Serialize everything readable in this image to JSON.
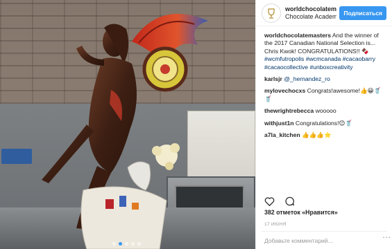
{
  "post": {
    "image_alt": "Chocolate sculpture of a woman with a colorful dragon",
    "carousel_dots": 5,
    "carousel_active": 1
  },
  "header": {
    "username": "worldchocolatemasters",
    "location": "Chocolate Academy",
    "follow_label": "Подписаться"
  },
  "comments": [
    {
      "user": "worldchocolatemasters",
      "text": "And the winner of the 2017 Canadian National Selection is... Chris Kwok! CONGRATULATIONS!! 🍫",
      "tags": "#wcmfutropolis #wcmcanada #cacaobarry #cacaocollective #unboxcreativity"
    },
    {
      "user": "karlsjr",
      "text": "@_hernandez_ro"
    },
    {
      "user": "mylovechocxs",
      "text": "Congrats!awesome!👍😀🥤🥤"
    },
    {
      "user": "thewrightrebecca",
      "text": "wooooo"
    },
    {
      "user": "withjust1n",
      "text": "Congratulations!😊🥤"
    },
    {
      "user": "a7la_kitchen",
      "text": "👍👍👍⭐"
    }
  ],
  "actions": {
    "like_icon": "heart-icon",
    "comment_icon": "comment-icon"
  },
  "likes": "382 отметок «Нравится»",
  "date": "17 июня",
  "add_comment": {
    "placeholder": "Добавьте комментарий..."
  },
  "colors": {
    "follow": "#3897f0",
    "tag": "#003569",
    "muted": "#999999"
  }
}
